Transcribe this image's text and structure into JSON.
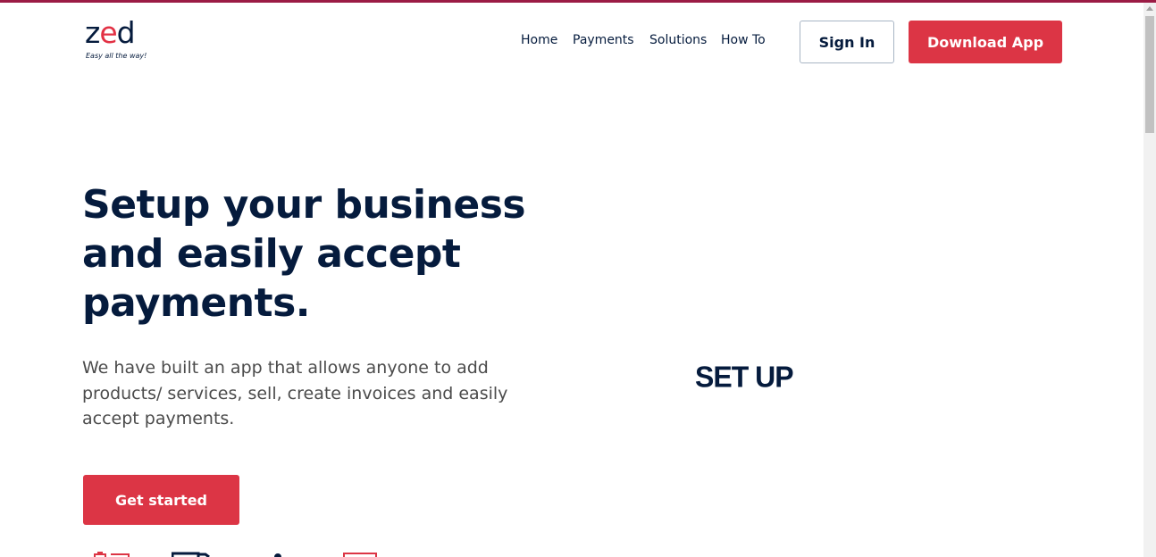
{
  "brand": {
    "logo_text": "zed",
    "tagline": "Easy all the way!"
  },
  "nav": {
    "items": [
      "Home",
      "Payments",
      "Solutions",
      "How To"
    ]
  },
  "header": {
    "signin_label": "Sign In",
    "download_label": "Download App"
  },
  "hero": {
    "title": "Setup your business and easily accept payments.",
    "description": "We have built an app that allows anyone to add products/ services, sell, create invoices and easily accept payments.",
    "cta_label": "Get started",
    "animation_text": "SET UP"
  },
  "colors": {
    "primary": "#dc3545",
    "navy": "#051b3d",
    "top_border": "#9b1c45"
  },
  "feature_icons": [
    "bag-icon",
    "truck-icon",
    "user-icon",
    "card-icon"
  ]
}
